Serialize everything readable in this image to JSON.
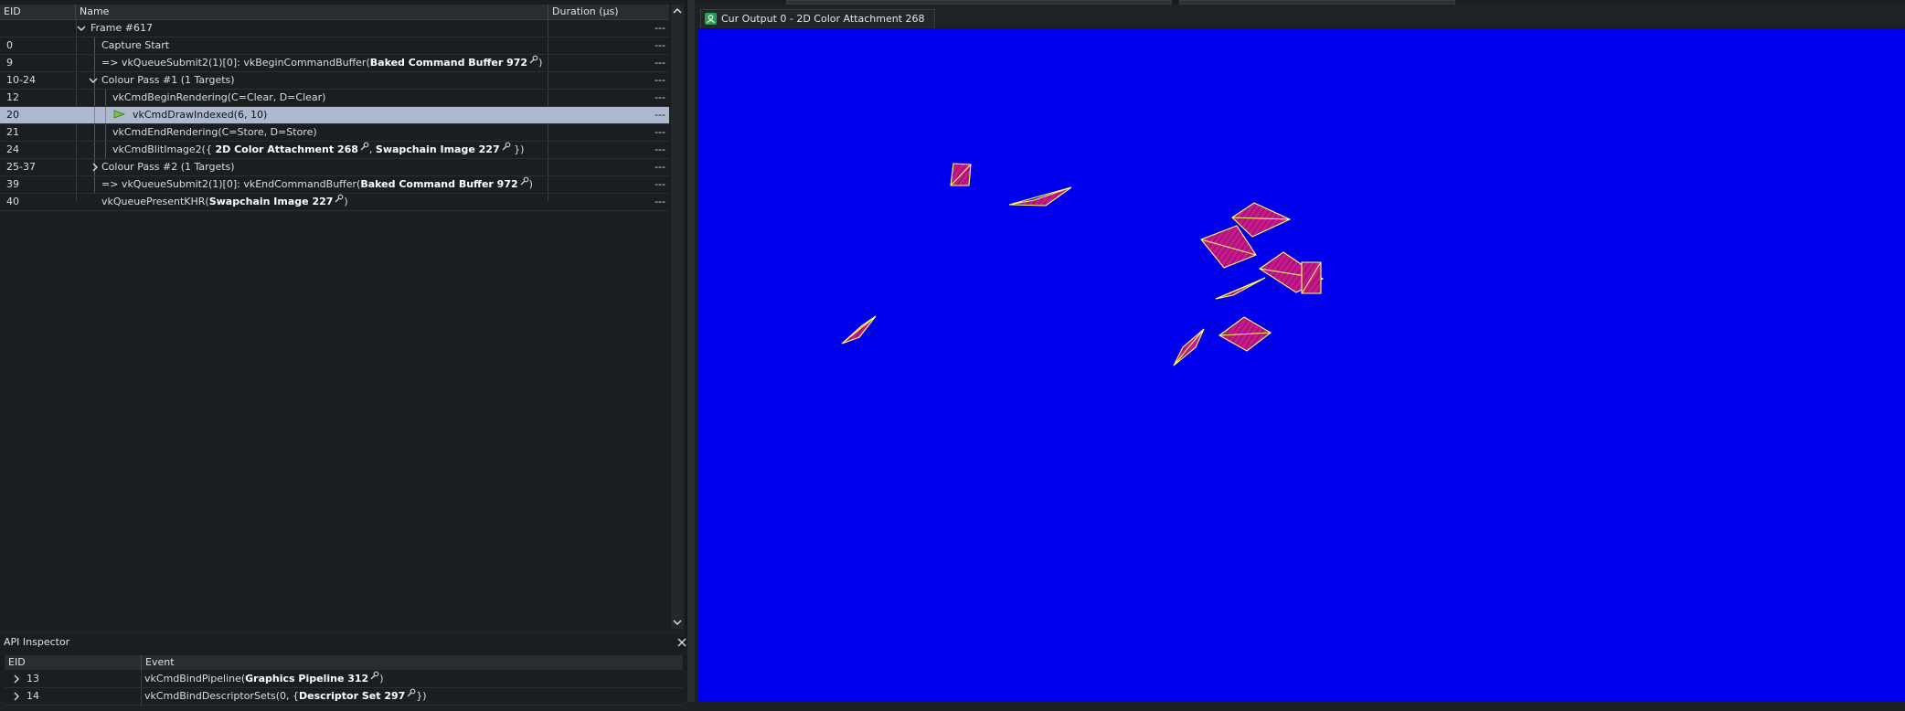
{
  "event_browser": {
    "columns": {
      "eid": "EID",
      "name": "Name",
      "duration": "Duration (µs)"
    },
    "rows": [
      {
        "eid": "",
        "name": "Frame #617",
        "duration": "---"
      },
      {
        "eid": "0",
        "name": "Capture Start",
        "duration": "---"
      },
      {
        "eid": "9",
        "pre": "=> vkQueueSubmit2(1)[0]: vkBeginCommandBuffer(",
        "res": "Baked Command Buffer 972",
        "post": ")",
        "duration": "---"
      },
      {
        "eid": "10-24",
        "name": "Colour Pass #1 (1 Targets)",
        "duration": "---"
      },
      {
        "eid": "12",
        "name": "vkCmdBeginRendering(C=Clear, D=Clear)",
        "duration": "---"
      },
      {
        "eid": "20",
        "name": "vkCmdDrawIndexed(6, 10)",
        "duration": "---"
      },
      {
        "eid": "21",
        "name": "vkCmdEndRendering(C=Store, D=Store)",
        "duration": "---"
      },
      {
        "eid": "24",
        "pre": "vkCmdBlitImage2({",
        "res": "2D Color Attachment 268",
        "mid": ",",
        "res2": "Swapchain Image 227",
        "post": "})",
        "duration": "---"
      },
      {
        "eid": "25-37",
        "name": "Colour Pass #2 (1 Targets)",
        "duration": "---"
      },
      {
        "eid": "39",
        "pre": "=> vkQueueSubmit2(1)[0]: vkEndCommandBuffer(",
        "res": "Baked Command Buffer 972",
        "post": ")",
        "duration": "---"
      },
      {
        "eid": "40",
        "pre": "vkQueuePresentKHR(",
        "res": "Swapchain Image 227",
        "post": ")",
        "duration": "---"
      }
    ]
  },
  "api_inspector": {
    "title": "API Inspector",
    "columns": {
      "eid": "EID",
      "event": "Event"
    },
    "rows": [
      {
        "eid": "13",
        "pre": "vkCmdBindPipeline(",
        "res": "Graphics Pipeline 312",
        "post": ")"
      },
      {
        "eid": "14",
        "pre": "vkCmdBindDescriptorSets(0, {",
        "res": "Descriptor Set 297",
        "post": "})"
      }
    ]
  },
  "texture_viewer": {
    "tab_label": "Cur Output 0 - 2D Color Attachment 268",
    "background_color": "#0000ee",
    "shape_fill": "#c8188c",
    "shape_outline": "#ffff66"
  }
}
